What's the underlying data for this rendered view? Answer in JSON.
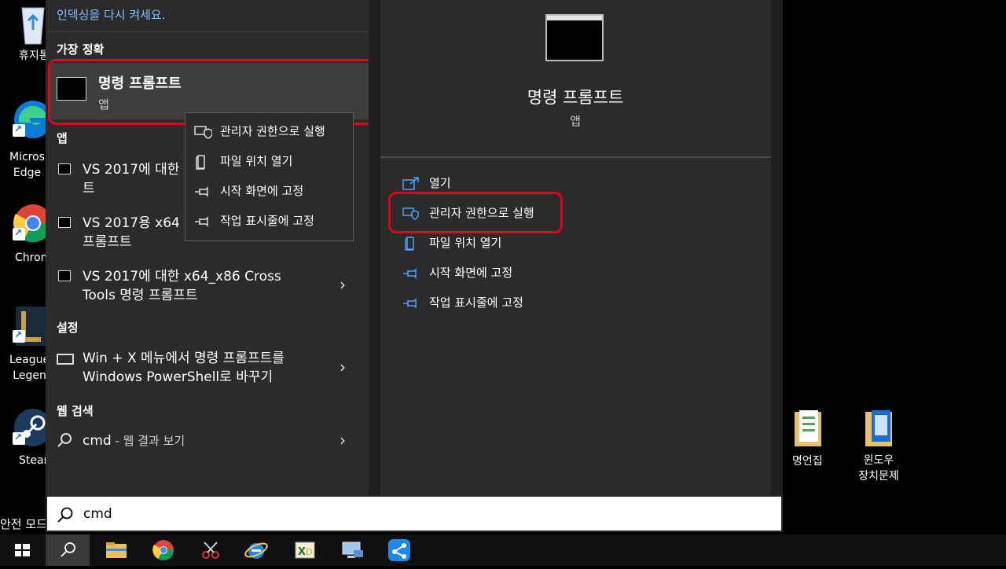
{
  "desktop": {
    "icons": [
      {
        "label": "휴지통"
      },
      {
        "label": "Micros\nEdge"
      },
      {
        "label": "Chrom"
      },
      {
        "label": "League\nLegen"
      },
      {
        "label": "Steam"
      },
      {
        "label": "명언집"
      },
      {
        "label": "윈도우\n장치문제"
      }
    ],
    "safe_mode_text": "안전 모드"
  },
  "left": {
    "top_hint": "인덱싱을 다시 켜세요.",
    "best_match_header": "가장 정확",
    "best_match": {
      "title": "명령 프롬프트",
      "subtitle": "앱"
    },
    "apps_header": "앱",
    "apps": [
      {
        "label_line1": "VS 2017에 대한",
        "label_line2": "트"
      },
      {
        "label_line1": "VS 2017용 x64",
        "label_line2": "프롬프트"
      },
      {
        "label_line1": "VS 2017에 대한 x64_x86 Cross",
        "label_line2": "Tools 명령 프롬프트"
      }
    ],
    "settings_header": "설정",
    "settings_item": {
      "line1": "Win + X 메뉴에서 명령 프롬프트를",
      "line2": "Windows PowerShell로 바꾸기"
    },
    "web_header": "웹 검색",
    "web_item": {
      "query": "cmd",
      "suffix": " - 웹 결과 보기"
    }
  },
  "context_menu": {
    "items": [
      {
        "label": "관리자 권한으로 실행",
        "icon": "shield-icon"
      },
      {
        "label": "파일 위치 열기",
        "icon": "file-icon"
      },
      {
        "label": "시작 화면에 고정",
        "icon": "pin-icon"
      },
      {
        "label": "작업 표시줄에 고정",
        "icon": "pin-icon"
      }
    ]
  },
  "right": {
    "title": "명령 프롬프트",
    "subtitle": "앱",
    "actions": [
      {
        "label": "열기",
        "icon": "open-icon"
      },
      {
        "label": "관리자 권한으로 실행",
        "icon": "shield-icon"
      },
      {
        "label": "파일 위치 열기",
        "icon": "file-icon"
      },
      {
        "label": "시작 화면에 고정",
        "icon": "pin-icon"
      },
      {
        "label": "작업 표시줄에 고정",
        "icon": "pin-icon"
      }
    ]
  },
  "search": {
    "value": "cmd"
  },
  "colors": {
    "highlight": "#e3001b",
    "accent": "#4aa3ff",
    "panel": "#2b2b2b"
  }
}
